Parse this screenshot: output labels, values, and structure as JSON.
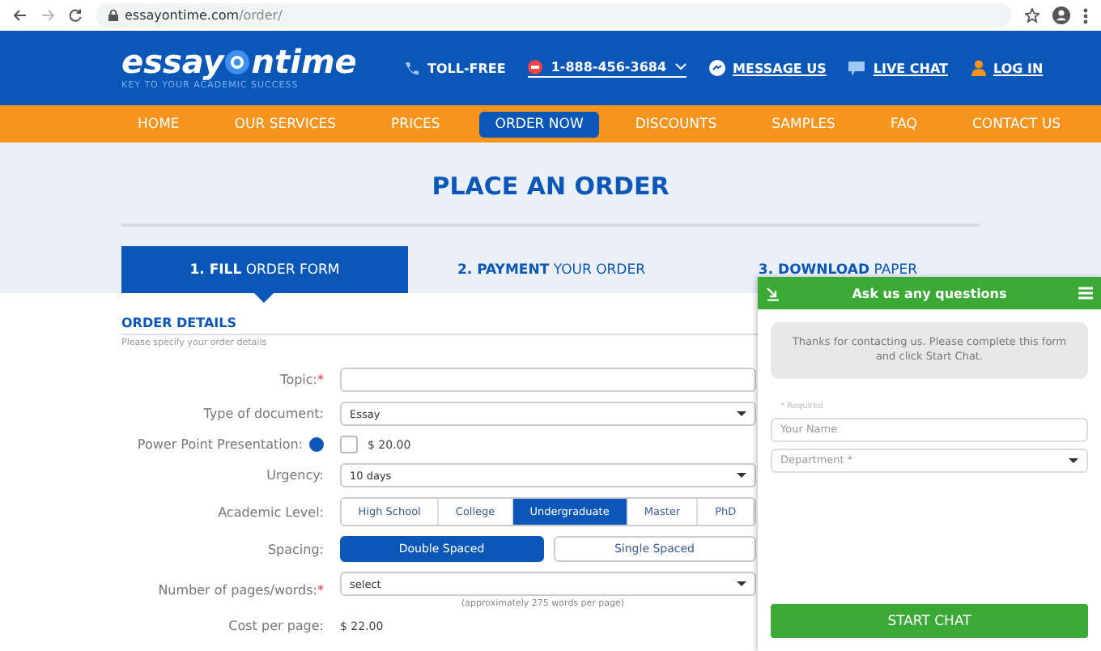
{
  "browser": {
    "url_host": "essayontime.com",
    "url_path": "/order/"
  },
  "header": {
    "logo_left": "essay",
    "logo_right": "ntime",
    "tagline": "KEY TO YOUR ACADEMIC SUCCESS",
    "toll_free": "TOLL-FREE",
    "phone": "1-888-456-3684",
    "links": [
      {
        "kind": "message",
        "label": "MESSAGE US"
      },
      {
        "kind": "chat",
        "label": "LIVE CHAT"
      },
      {
        "kind": "login",
        "label": "LOG IN"
      }
    ]
  },
  "nav": [
    {
      "label": "HOME",
      "selected": false
    },
    {
      "label": "OUR SERVICES",
      "selected": false
    },
    {
      "label": "PRICES",
      "selected": false
    },
    {
      "label": "ORDER NOW",
      "selected": true
    },
    {
      "label": "DISCOUNTS",
      "selected": false
    },
    {
      "label": "SAMPLES",
      "selected": false
    },
    {
      "label": "FAQ",
      "selected": false
    },
    {
      "label": "CONTACT US",
      "selected": false
    }
  ],
  "title": "PLACE AN ORDER",
  "steps": [
    {
      "label": "**1. FILL** ORDER FORM",
      "selected": true
    },
    {
      "label": "**2. PAYMENT** YOUR ORDER",
      "selected": false
    },
    {
      "label": "**3. DOWNLOAD** PAPER",
      "selected": false
    }
  ],
  "section": {
    "title": "ORDER DETAILS",
    "subtitle": "Please specify your order details"
  },
  "form": [
    {
      "kind": "text",
      "label": "Topic:",
      "required_mark": "*"
    },
    {
      "kind": "select",
      "label": "Type of document:",
      "value": "Essay"
    },
    {
      "kind": "checkbox",
      "label": "Power Point Presentation:",
      "checked": false,
      "price": "$ 20.00"
    },
    {
      "kind": "select",
      "label": "Urgency:",
      "value": "10 days"
    },
    {
      "kind": "segments",
      "label": "Academic Level:",
      "options": [
        {
          "label": "High School",
          "selected": false
        },
        {
          "label": "College",
          "selected": false
        },
        {
          "label": "Undergraduate",
          "selected": true
        },
        {
          "label": "Master",
          "selected": false
        },
        {
          "label": "PhD",
          "selected": false
        }
      ]
    },
    {
      "kind": "toggle",
      "label": "Spacing:",
      "options": [
        {
          "label": "Double Spaced",
          "selected": true
        },
        {
          "label": "Single Spaced",
          "selected": false
        }
      ]
    },
    {
      "kind": "select",
      "label": "Number of pages/words:",
      "required_mark": "*",
      "value": "select",
      "note": "(approximately 275 words per page)"
    },
    {
      "kind": "static",
      "label": "Cost per page:",
      "value": "$ 22.00"
    }
  ],
  "chat": {
    "title": "Ask us any questions",
    "message": "Thanks for contacting us. Please complete this form and click Start Chat.",
    "required_note": "* Required",
    "name_placeholder": "Your Name",
    "department_placeholder": "Department *",
    "button": "START CHAT"
  }
}
